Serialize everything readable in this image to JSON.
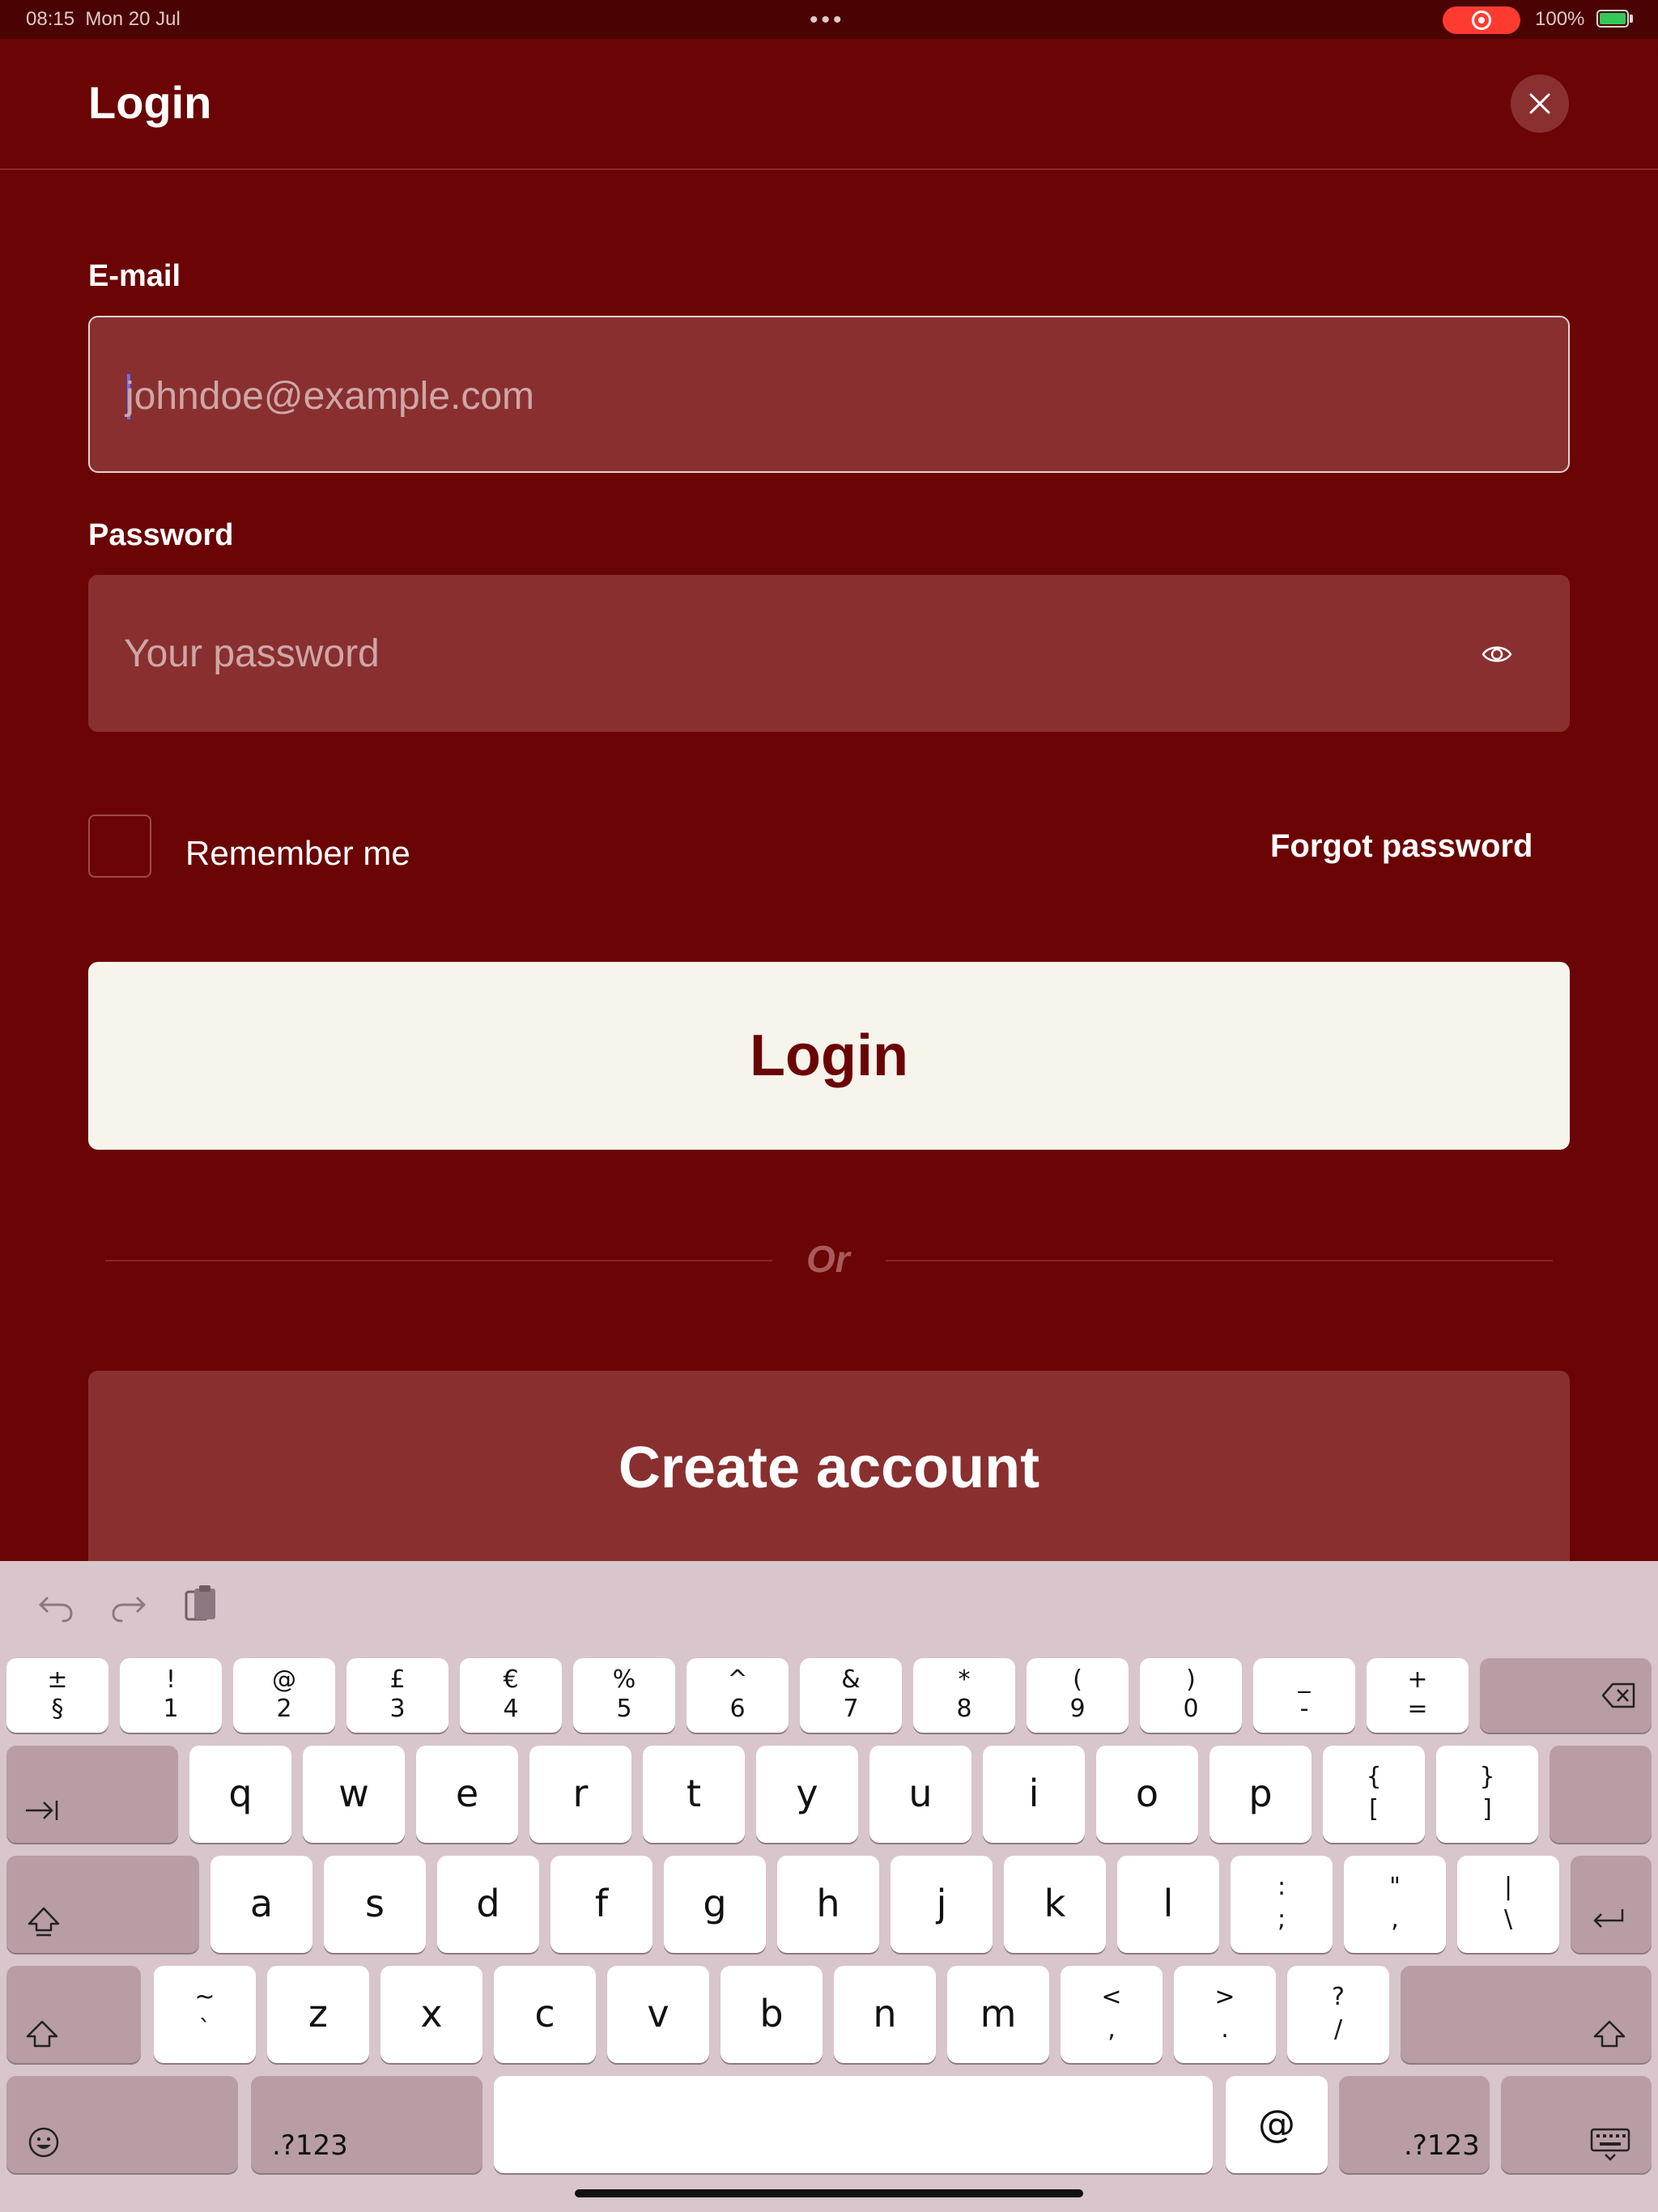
{
  "status_bar": {
    "time": "08:15",
    "date": "Mon 20 Jul",
    "dots": "•••",
    "battery_percent": "100%",
    "battery_level": 1.0,
    "recording": true
  },
  "colors": {
    "background": "#6b0404",
    "field": "#892f2f",
    "primary_button": "#f7f4ec",
    "keyboard": "#d9c5cc"
  },
  "header": {
    "title": "Login",
    "close_icon": "close-icon"
  },
  "form": {
    "email_label": "E-mail",
    "email_placeholder": "johndoe@example.com",
    "email_value": "",
    "password_label": "Password",
    "password_placeholder": "Your password",
    "password_value": "",
    "eye_icon": "eye-icon",
    "remember_label": "Remember me",
    "remember_checked": false,
    "forgot_label": "Forgot password",
    "login_label": "Login",
    "or_label": "Or",
    "create_label": "Create account"
  },
  "keyboard": {
    "toolbar": [
      "undo-icon",
      "redo-icon",
      "paste-icon"
    ],
    "row1": [
      {
        "top": "±",
        "bot": "§"
      },
      {
        "top": "!",
        "bot": "1"
      },
      {
        "top": "@",
        "bot": "2"
      },
      {
        "top": "£",
        "bot": "3"
      },
      {
        "top": "€",
        "bot": "4"
      },
      {
        "top": "%",
        "bot": "5"
      },
      {
        "top": "^",
        "bot": "6"
      },
      {
        "top": "&",
        "bot": "7"
      },
      {
        "top": "*",
        "bot": "8"
      },
      {
        "top": "(",
        "bot": "9"
      },
      {
        "top": ")",
        "bot": "0"
      },
      {
        "top": "_",
        "bot": "-"
      },
      {
        "top": "+",
        "bot": "="
      }
    ],
    "row2": [
      "q",
      "w",
      "e",
      "r",
      "t",
      "y",
      "u",
      "i",
      "o",
      "p"
    ],
    "row2_extra": [
      {
        "top": "{",
        "bot": "["
      },
      {
        "top": "}",
        "bot": "]"
      }
    ],
    "row3": [
      "a",
      "s",
      "d",
      "f",
      "g",
      "h",
      "j",
      "k",
      "l"
    ],
    "row3_extra": [
      {
        "top": ":",
        "bot": ";"
      },
      {
        "top": "\"",
        "bot": ","
      },
      {
        "top": "|",
        "bot": "\\"
      }
    ],
    "row4_first": {
      "top": "~",
      "bot": "`"
    },
    "row4": [
      "z",
      "x",
      "c",
      "v",
      "b",
      "n",
      "m"
    ],
    "row4_extra": [
      {
        "top": "<",
        "bot": ","
      },
      {
        "top": ">",
        "bot": "."
      },
      {
        "top": "?",
        "bot": "/"
      }
    ],
    "at_key": "@",
    "numbers_label": ".?123",
    "numbers_label_right": ".?123"
  }
}
